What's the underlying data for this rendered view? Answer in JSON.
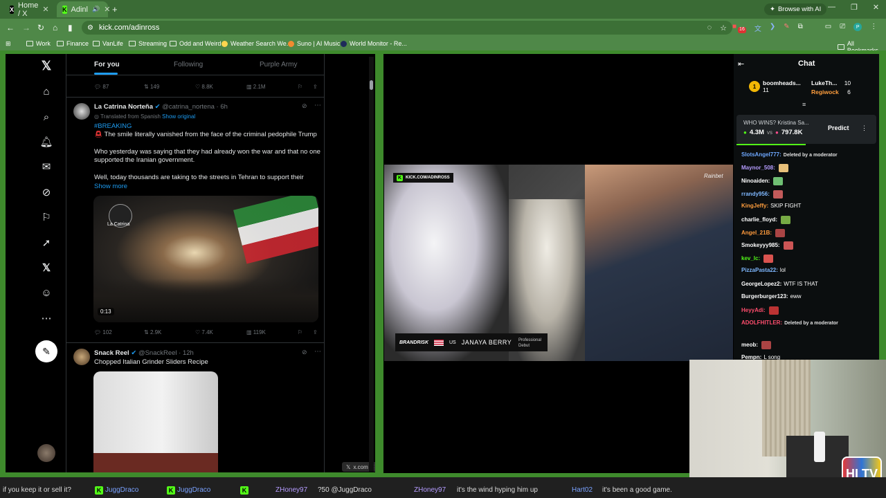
{
  "browser": {
    "tabs": [
      {
        "label": "Home / X"
      },
      {
        "label": "Adinl"
      }
    ],
    "browse_ai": "Browse with AI",
    "url": "kick.com/adinross",
    "badge": "16"
  },
  "bookmarks": [
    "Work",
    "Finance",
    "VanLife",
    "Streaming",
    "Odd and Weird",
    "Weather Search We...",
    "Suno | AI Music",
    "World Monitor - Re...",
    "All Bookmarks"
  ],
  "x": {
    "feed_tabs": [
      "For you",
      "Following",
      "Purple Army"
    ],
    "top_stats": {
      "replies": "87",
      "reposts": "149",
      "likes": "8.8K",
      "views": "2.1M"
    },
    "tweet1": {
      "name": "La Catrina Norteña",
      "handle": "@catrina_nortena · 6h",
      "translated": "Translated from Spanish",
      "show_original": "Show original",
      "hashtag": "#BREAKING",
      "line1": "The smile literally vanished from the face of the criminal pedophile Trump",
      "line2": "Who yesterday was saying that they had already won the war and that no one supported the Iranian government.",
      "line3": "Well, today thousands are taking to the streets in Tehran to support their",
      "show_more": "Show more",
      "video_time": "0:13",
      "watermark": "La Catrina",
      "stats": {
        "replies": "102",
        "reposts": "2.9K",
        "likes": "7.4K",
        "views": "119K"
      }
    },
    "tweet2": {
      "name": "Snack Reel",
      "handle": "@SnackReel · 12h",
      "text": "Chopped Italian Grinder Sliders Recipe"
    },
    "status_chip": "x.com"
  },
  "kick": {
    "chat_title": "Chat",
    "leaders": [
      {
        "name": "boomheads...",
        "score": "11"
      },
      {
        "name": "LukeTh...",
        "score": "10"
      },
      {
        "name": "Regiwock",
        "score": "6"
      }
    ],
    "prediction": {
      "question": "WHO WINS? Kristina Sa...",
      "left": "4.3M",
      "vs": "vs",
      "right": "797.8K",
      "button": "Predict"
    },
    "overlay_brand": "KICK.COM/ADINROSS",
    "lower_third": {
      "promo": "BRANDRISK",
      "country": "US",
      "fighter": "JANAYA BERRY",
      "note": "Professional Debut"
    },
    "sponsor": "Rainbet",
    "messages": [
      {
        "user": "SlotsAngel777:",
        "text": "Deleted by a moderator",
        "color": "#6ea8ff"
      },
      {
        "user": "Maynor_508:",
        "text": "",
        "color": "#b59cff"
      },
      {
        "user": "Ninoaiden:",
        "text": "",
        "color": "#ffffff"
      },
      {
        "user": "rrandy956:",
        "text": "",
        "color": "#7fb8ff"
      },
      {
        "user": "KingJeffy:",
        "text": "SKIP FIGHT",
        "color": "#ff9e3d"
      },
      {
        "user": "charlie_floyd:",
        "text": "",
        "color": "#ffffff"
      },
      {
        "user": "Angel_21B:",
        "text": "",
        "color": "#ff9a3c"
      },
      {
        "user": "Smokeyyy985:",
        "text": "",
        "color": "#ffffff"
      },
      {
        "user": "kev_lc:",
        "text": "",
        "color": "#53fc18"
      },
      {
        "user": "PizzaPasta22:",
        "text": "lol",
        "color": "#7fb8ff"
      },
      {
        "user": "GeorgeLopez2:",
        "text": "WTF IS THAT",
        "color": "#ffffff"
      },
      {
        "user": "Burgerburger123:",
        "text": "eww",
        "color": "#ffffff"
      },
      {
        "user": "HeyyAdi:",
        "text": "",
        "color": "#ff4d6d"
      },
      {
        "user": "ADOLFHITLER:",
        "text": "Deleted by a moderator",
        "color": "#ff4d6d"
      },
      {
        "user": "meob:",
        "text": "",
        "color": "#ffffff"
      },
      {
        "user": "Pempn:",
        "text": "L song",
        "color": "#ffffff"
      }
    ]
  },
  "ticker": {
    "segments": [
      "if you keep it or sell it?",
      "JuggDraco",
      "JuggDraco",
      "ZHoney97",
      "?50 @JuggDraco",
      "ZHoney97",
      "it's the wind hyping him up",
      "Hart02",
      "it's been a good game."
    ]
  },
  "logo": "HI TV"
}
